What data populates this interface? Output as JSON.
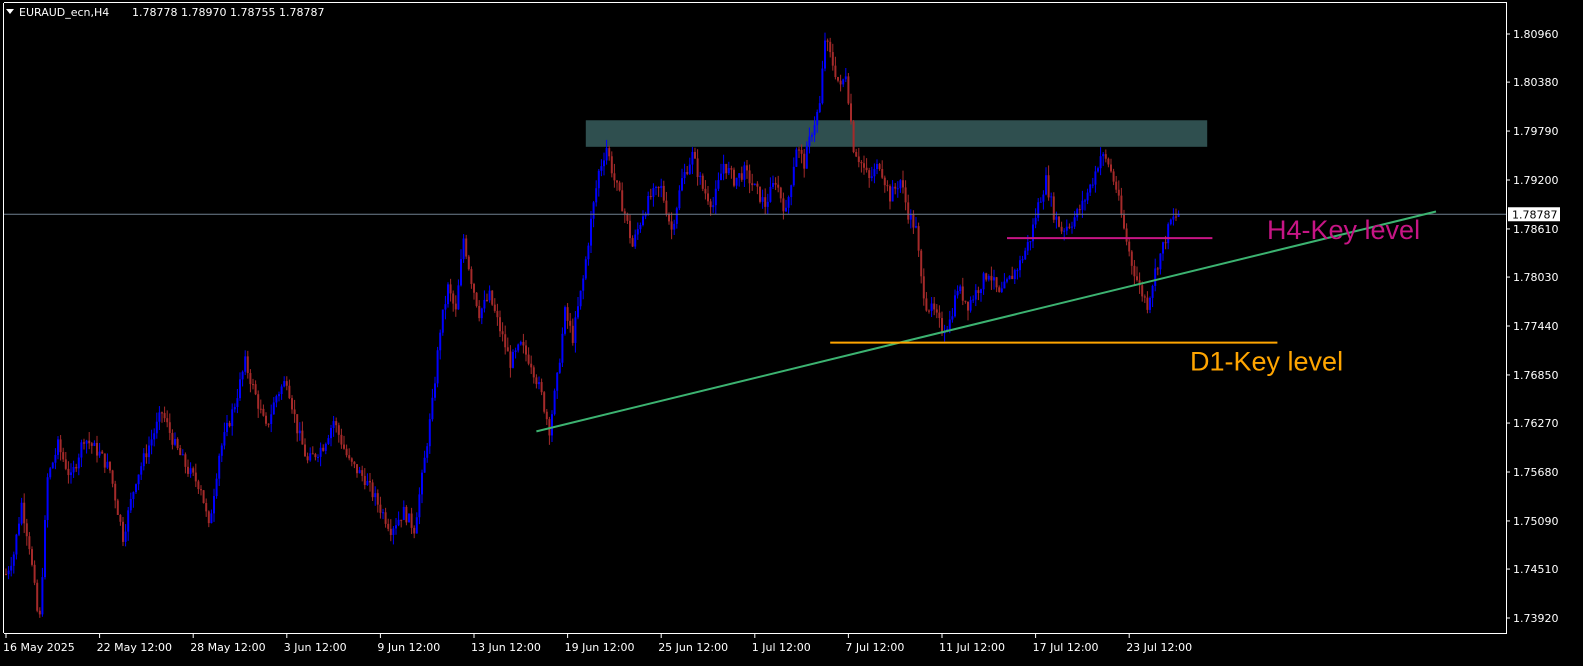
{
  "header": {
    "symbol": "EURAUD_ecn,H4",
    "ohlc": "1.78778 1.78970 1.78755 1.78787"
  },
  "chart_data": {
    "type": "candlestick",
    "symbol": "EURAUD_ecn",
    "timeframe": "H4",
    "current_price": 1.78787,
    "current_price_label": "1.78787",
    "ylim": [
      1.7362,
      1.8126
    ],
    "y_ticks": [
      {
        "value": 1.7392,
        "label": "1.73920"
      },
      {
        "value": 1.7451,
        "label": "1.74510"
      },
      {
        "value": 1.7509,
        "label": "1.75090"
      },
      {
        "value": 1.7568,
        "label": "1.75680"
      },
      {
        "value": 1.7627,
        "label": "1.76270"
      },
      {
        "value": 1.7685,
        "label": "1.76850"
      },
      {
        "value": 1.7744,
        "label": "1.77440"
      },
      {
        "value": 1.7803,
        "label": "1.78030"
      },
      {
        "value": 1.7861,
        "label": "1.78610"
      },
      {
        "value": 1.792,
        "label": "1.79200"
      },
      {
        "value": 1.7979,
        "label": "1.79790"
      },
      {
        "value": 1.8038,
        "label": "1.80380"
      },
      {
        "value": 1.8096,
        "label": "1.80960"
      }
    ],
    "x_ticks": [
      {
        "bar": 0,
        "label": "16 May 2025"
      },
      {
        "bar": 36,
        "label": "22 May 12:00"
      },
      {
        "bar": 72,
        "label": "28 May 12:00"
      },
      {
        "bar": 108,
        "label": "3 Jun 12:00"
      },
      {
        "bar": 144,
        "label": "9 Jun 12:00"
      },
      {
        "bar": 180,
        "label": "13 Jun 12:00"
      },
      {
        "bar": 216,
        "label": "19 Jun 12:00"
      },
      {
        "bar": 252,
        "label": "25 Jun 12:00"
      },
      {
        "bar": 288,
        "label": "1 Jul 12:00"
      },
      {
        "bar": 324,
        "label": "7 Jul 12:00"
      },
      {
        "bar": 360,
        "label": "11 Jul 12:00"
      },
      {
        "bar": 396,
        "label": "17 Jul 12:00"
      },
      {
        "bar": 432,
        "label": "23 Jul 12:00"
      }
    ],
    "bar_count": 452,
    "close_path": [
      [
        0,
        1.7445
      ],
      [
        3,
        1.747
      ],
      [
        6,
        1.753
      ],
      [
        9,
        1.748
      ],
      [
        12,
        1.74
      ],
      [
        13,
        1.7392
      ],
      [
        16,
        1.756
      ],
      [
        20,
        1.76
      ],
      [
        25,
        1.756
      ],
      [
        30,
        1.761
      ],
      [
        36,
        1.759
      ],
      [
        40,
        1.757
      ],
      [
        45,
        1.749
      ],
      [
        50,
        1.756
      ],
      [
        55,
        1.76
      ],
      [
        60,
        1.764
      ],
      [
        65,
        1.76
      ],
      [
        70,
        1.757
      ],
      [
        75,
        1.755
      ],
      [
        78,
        1.75
      ],
      [
        82,
        1.759
      ],
      [
        88,
        1.765
      ],
      [
        92,
        1.77
      ],
      [
        96,
        1.766
      ],
      [
        100,
        1.762
      ],
      [
        104,
        1.766
      ],
      [
        108,
        1.768
      ],
      [
        112,
        1.762
      ],
      [
        116,
        1.758
      ],
      [
        122,
        1.76
      ],
      [
        126,
        1.763
      ],
      [
        132,
        1.758
      ],
      [
        138,
        1.756
      ],
      [
        143,
        1.753
      ],
      [
        148,
        1.75
      ],
      [
        153,
        1.752
      ],
      [
        157,
        1.75
      ],
      [
        160,
        1.756
      ],
      [
        164,
        1.765
      ],
      [
        167,
        1.774
      ],
      [
        170,
        1.779
      ],
      [
        173,
        1.776
      ],
      [
        176,
        1.785
      ],
      [
        179,
        1.78
      ],
      [
        182,
        1.776
      ],
      [
        186,
        1.778
      ],
      [
        190,
        1.774
      ],
      [
        194,
        1.77
      ],
      [
        198,
        1.772
      ],
      [
        202,
        1.77
      ],
      [
        206,
        1.766
      ],
      [
        209,
        1.762
      ],
      [
        212,
        1.768
      ],
      [
        215,
        1.776
      ],
      [
        218,
        1.773
      ],
      [
        222,
        1.78
      ],
      [
        225,
        1.787
      ],
      [
        228,
        1.793
      ],
      [
        231,
        1.796
      ],
      [
        234,
        1.792
      ],
      [
        238,
        1.788
      ],
      [
        241,
        1.784
      ],
      [
        245,
        1.788
      ],
      [
        248,
        1.79
      ],
      [
        252,
        1.791
      ],
      [
        256,
        1.786
      ],
      [
        260,
        1.792
      ],
      [
        264,
        1.795
      ],
      [
        268,
        1.791
      ],
      [
        272,
        1.789
      ],
      [
        276,
        1.794
      ],
      [
        280,
        1.792
      ],
      [
        284,
        1.793
      ],
      [
        288,
        1.791
      ],
      [
        292,
        1.789
      ],
      [
        296,
        1.792
      ],
      [
        300,
        1.788
      ],
      [
        304,
        1.796
      ],
      [
        307,
        1.794
      ],
      [
        310,
        1.798
      ],
      [
        313,
        1.801
      ],
      [
        315,
        1.809
      ],
      [
        318,
        1.806
      ],
      [
        321,
        1.803
      ],
      [
        323,
        1.805
      ],
      [
        326,
        1.796
      ],
      [
        329,
        1.794
      ],
      [
        332,
        1.792
      ],
      [
        336,
        1.794
      ],
      [
        340,
        1.79
      ],
      [
        344,
        1.792
      ],
      [
        347,
        1.788
      ],
      [
        350,
        1.786
      ],
      [
        352,
        1.78
      ],
      [
        354,
        1.777
      ],
      [
        357,
        1.776
      ],
      [
        360,
        1.774
      ],
      [
        363,
        1.775
      ],
      [
        366,
        1.779
      ],
      [
        370,
        1.777
      ],
      [
        374,
        1.779
      ],
      [
        378,
        1.781
      ],
      [
        382,
        1.778
      ],
      [
        386,
        1.78
      ],
      [
        390,
        1.782
      ],
      [
        394,
        1.785
      ],
      [
        397,
        1.789
      ],
      [
        400,
        1.792
      ],
      [
        403,
        1.788
      ],
      [
        406,
        1.786
      ],
      [
        410,
        1.787
      ],
      [
        414,
        1.789
      ],
      [
        418,
        1.792
      ],
      [
        421,
        1.795
      ],
      [
        424,
        1.794
      ],
      [
        427,
        1.791
      ],
      [
        430,
        1.786
      ],
      [
        433,
        1.782
      ],
      [
        436,
        1.779
      ],
      [
        439,
        1.777
      ],
      [
        442,
        1.781
      ],
      [
        445,
        1.784
      ],
      [
        448,
        1.787
      ],
      [
        451,
        1.78787
      ]
    ],
    "annotations": [
      {
        "type": "zone",
        "bar_from": 223,
        "bar_to": 462,
        "y_from": 1.796,
        "y_to": 1.7992,
        "color": "#2f4f4f"
      },
      {
        "type": "hline",
        "name": "H4-Key level",
        "label": "H4-Key level",
        "bar_from": 385,
        "bar_to": 464,
        "y": 1.785,
        "color": "#c71585"
      },
      {
        "type": "hline",
        "name": "D1-Key level",
        "label": "D1-Key level",
        "bar_from": 317,
        "bar_to": 489,
        "y": 1.7724,
        "color": "#ffa500"
      },
      {
        "type": "trendline",
        "bar_from": 204,
        "bar_to": 550,
        "y_from": 1.7617,
        "y_to": 1.7882,
        "color": "#3cb371"
      }
    ],
    "colors": {
      "background": "#000000",
      "bull": "#0000ff",
      "bear": "#a52a2a",
      "axis": "#ffffff",
      "price_line": "#708090"
    },
    "grid": false,
    "legend": "none"
  }
}
